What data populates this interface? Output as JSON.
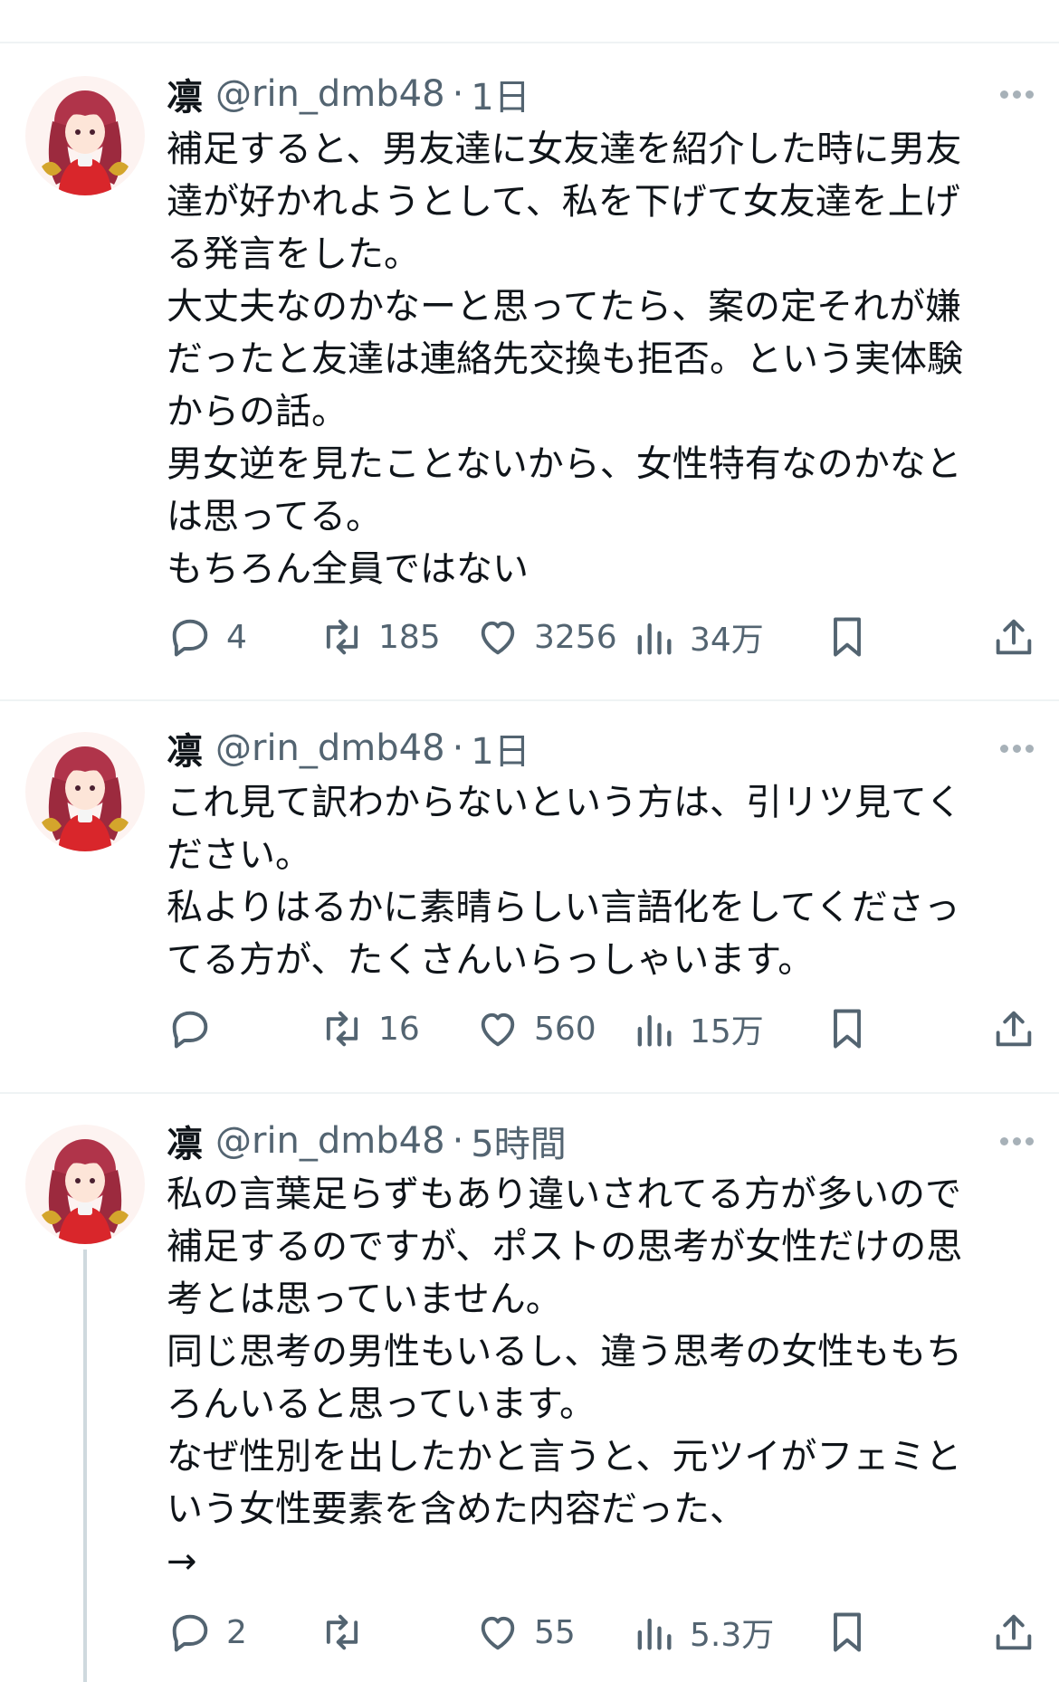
{
  "posts": [
    {
      "name": "凛",
      "handle": "@rin_dmb48",
      "separator": "·",
      "time": "1日",
      "lines": [
        "補足すると、男友達に女友達を紹介した時に男友",
        "達が好かれようとして、私を下げて女友達を上げ",
        "る発言をした。",
        "大丈夫なのかなーと思ってたら、案の定それが嫌",
        "だったと友達は連絡先交換も拒否。という実体験",
        "からの話。",
        "男女逆を見たことないから、女性特有なのかなと",
        "は思ってる。",
        "もちろん全員ではない"
      ],
      "replies": "4",
      "reposts": "185",
      "likes": "3256",
      "views": "34万"
    },
    {
      "name": "凛",
      "handle": "@rin_dmb48",
      "separator": "·",
      "time": "1日",
      "lines": [
        "これ見て訳わからないという方は、引リツ見てく",
        "ださい。",
        "私よりはるかに素晴らしい言語化をしてくださっ",
        "てる方が、たくさんいらっしゃいます。"
      ],
      "replies": "",
      "reposts": "16",
      "likes": "560",
      "views": "15万"
    },
    {
      "name": "凛",
      "handle": "@rin_dmb48",
      "separator": "·",
      "time": "5時間",
      "lines": [
        "私の言葉足らずもあり違いされてる方が多いので",
        "補足するのですが、ポストの思考が女性だけの思",
        "考とは思っていません。",
        "同じ思考の男性もいるし、違う思考の女性ももち",
        "ろんいると思っています。",
        "なぜ性別を出したかと言うと、元ツイがフェミと",
        "いう女性要素を含めた内容だった、",
        "→"
      ],
      "replies": "2",
      "reposts": "",
      "likes": "55",
      "views": "5.3万"
    }
  ],
  "icons": {
    "reply": "reply-icon",
    "repost": "repost-icon",
    "like": "like-icon",
    "views": "views-icon",
    "bookmark": "bookmark-icon",
    "share": "share-icon",
    "more": "more-icon",
    "avatar": "avatar-anime-girl"
  },
  "colors": {
    "text": "#0f1419",
    "secondary": "#536471",
    "divider": "#eff3f4",
    "avatar_hair": "#b0344a",
    "avatar_dress": "#d9262b"
  }
}
